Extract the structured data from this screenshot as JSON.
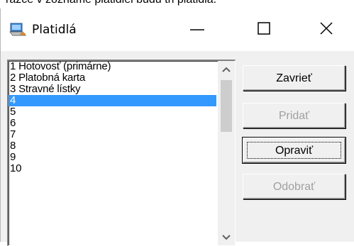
{
  "caption_fragment": "rázce v zozname platidiel budú tri platidlá.",
  "window": {
    "title": "Platidlá",
    "minimize_label": "—",
    "maximize_label": "☐",
    "close_label": "✕"
  },
  "list": {
    "selected_index": 3,
    "items": [
      "1 Hotovosť (primárne)",
      "2 Platobná karta",
      "3 Stravné lístky",
      "4",
      "5",
      "6",
      "7",
      "8",
      "9",
      "10"
    ]
  },
  "buttons": {
    "close": "Zavrieť",
    "add": "Pridať",
    "edit": "Opraviť",
    "remove": "Odobrať"
  },
  "colors": {
    "selection": "#3399ff",
    "disabled_text": "#a0a0a0"
  }
}
